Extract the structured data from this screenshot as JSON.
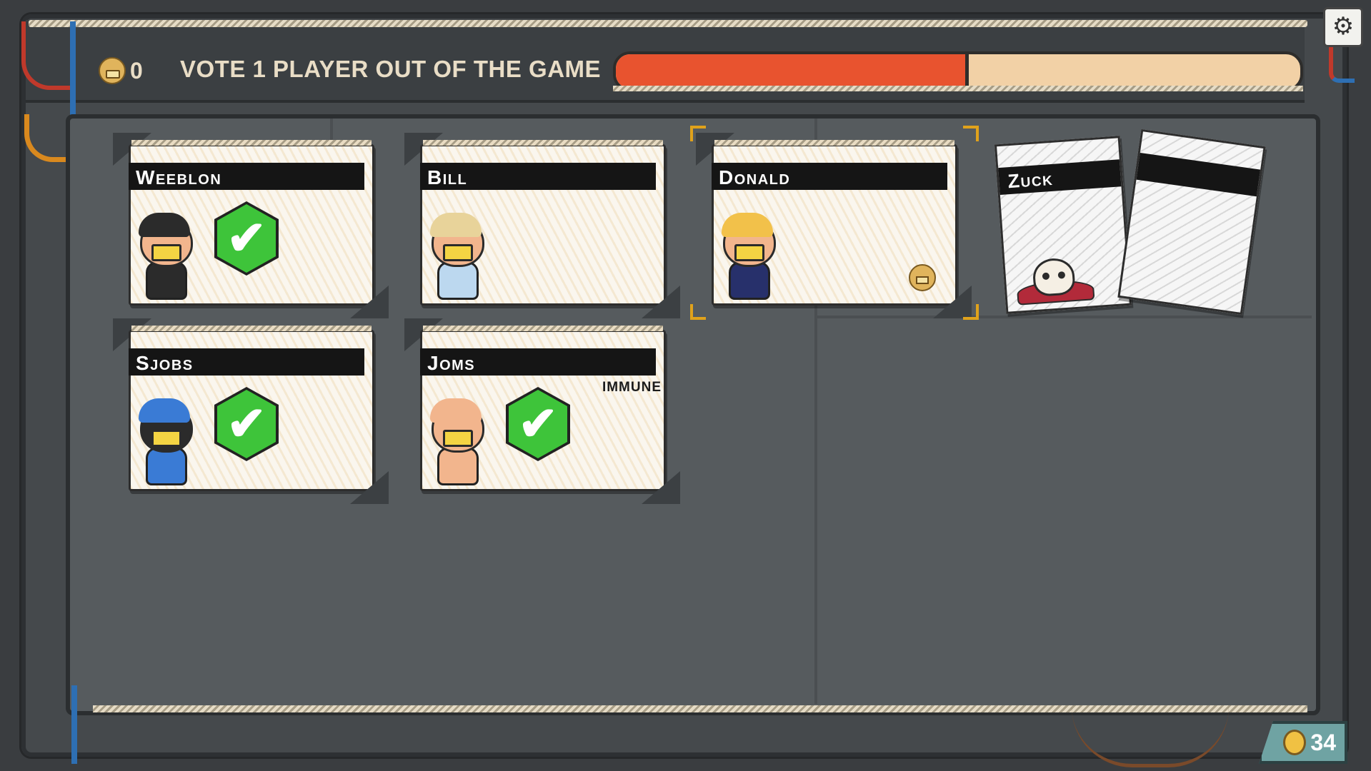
{
  "hud": {
    "coins": "0",
    "title": "VOTE 1 PLAYER OUT OF THE GAME",
    "timer_progress": 0.51,
    "money": "34"
  },
  "icons": {
    "settings": "gear-icon",
    "coin": "coin-face-icon",
    "check": "checkmark-icon",
    "dead": "skull-icon"
  },
  "colors": {
    "timer_fill": "#e8532f",
    "timer_track": "#f2d1a6",
    "check_green": "#3ec43a",
    "highlight": "#e0a21b"
  },
  "players": [
    {
      "name": "Weeblon",
      "voted": true,
      "immune": "",
      "has_coin": false,
      "selected": false,
      "skin": "#f2b58d",
      "hair": "#2b2b2b",
      "shirt": "#2b2b2b"
    },
    {
      "name": "Bill",
      "voted": false,
      "immune": "",
      "has_coin": false,
      "selected": false,
      "skin": "#f2b58d",
      "hair": "#e8d39a",
      "shirt": "#bcd8ef"
    },
    {
      "name": "Donald",
      "voted": false,
      "immune": "",
      "has_coin": true,
      "selected": true,
      "skin": "#f2b58d",
      "hair": "#f2c14a",
      "shirt": "#27306b"
    },
    {
      "name": "SJobs",
      "voted": true,
      "immune": "",
      "has_coin": false,
      "selected": false,
      "skin": "#2b2b2b",
      "hair": "#3a7bd5",
      "shirt": "#3a7bd5"
    },
    {
      "name": "Joms",
      "voted": true,
      "immune": "IMMUNE",
      "has_coin": false,
      "selected": false,
      "skin": "#f2b58d",
      "hair": "#f2b58d",
      "shirt": "#f2b58d"
    }
  ],
  "eliminated": [
    {
      "name": "Zuck"
    },
    {
      "name": ""
    }
  ]
}
